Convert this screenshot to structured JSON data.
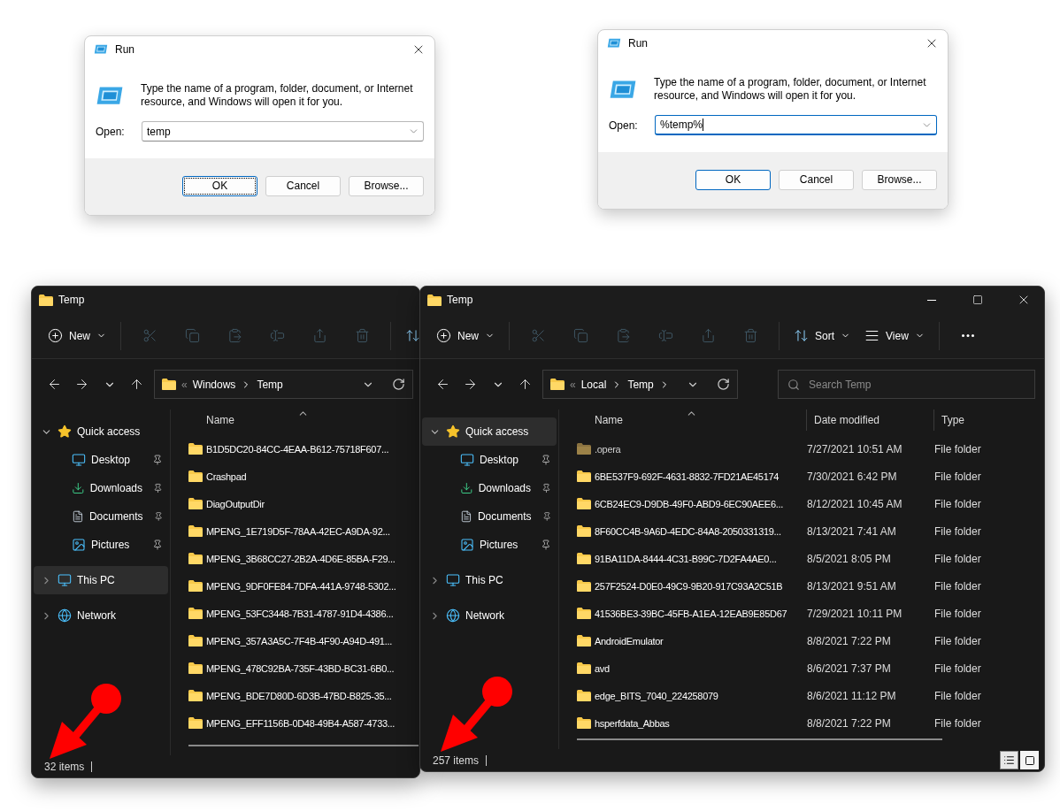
{
  "run_dialogs": [
    {
      "title": "Run",
      "description": "Type the name of a program, folder, document, or Internet resource, and Windows will open it for you.",
      "open_label": "Open:",
      "input": {
        "value": "temp",
        "focused": false
      },
      "buttons": [
        {
          "label": "OK",
          "default": true,
          "focused": true
        },
        {
          "label": "Cancel",
          "default": false,
          "focused": false
        },
        {
          "label": "Browse...",
          "default": false,
          "focused": false
        }
      ]
    },
    {
      "title": "Run",
      "description": "Type the name of a program, folder, document, or Internet resource, and Windows will open it for you.",
      "open_label": "Open:",
      "input": {
        "value": "%temp%",
        "focused": true
      },
      "buttons": [
        {
          "label": "OK",
          "default": true,
          "focused": false
        },
        {
          "label": "Cancel",
          "default": false,
          "focused": false
        },
        {
          "label": "Browse...",
          "default": false,
          "focused": false
        }
      ]
    }
  ],
  "explorers": [
    {
      "title": "Temp",
      "toolbar": [
        {
          "kind": "new",
          "label": "New",
          "disabled": false
        },
        {
          "kind": "separator"
        },
        {
          "kind": "cut",
          "disabled": true
        },
        {
          "kind": "copy",
          "disabled": true
        },
        {
          "kind": "paste",
          "disabled": true
        },
        {
          "kind": "rename",
          "disabled": true
        },
        {
          "kind": "share",
          "disabled": true
        },
        {
          "kind": "delete",
          "disabled": true
        },
        {
          "kind": "separator"
        },
        {
          "kind": "sort",
          "disabled": false
        }
      ],
      "address": {
        "overflow": "«",
        "crumbs": [
          "Windows",
          "Temp"
        ],
        "trailing_chevron": false
      },
      "sidebar": [
        {
          "label": "Quick access",
          "kind": "quick-access",
          "expanded": true,
          "selected": false,
          "children": [
            {
              "label": "Desktop",
              "kind": "desktop",
              "pinned": true,
              "selected": false
            },
            {
              "label": "Downloads",
              "kind": "downloads",
              "pinned": true,
              "selected": false
            },
            {
              "label": "Documents",
              "kind": "documents",
              "pinned": true,
              "selected": false
            },
            {
              "label": "Pictures",
              "kind": "pictures",
              "pinned": true,
              "selected": false
            }
          ]
        },
        {
          "label": "This PC",
          "kind": "this-pc",
          "expanded": false,
          "selected": true
        },
        {
          "label": "Network",
          "kind": "network",
          "expanded": false,
          "selected": false
        }
      ],
      "columns": [
        "Name"
      ],
      "rows": [
        {
          "hidden": false,
          "cells": [
            "B1D5DC20-84CC-4EAA-B612-75718F607..."
          ]
        },
        {
          "hidden": false,
          "cells": [
            "Crashpad"
          ]
        },
        {
          "hidden": false,
          "cells": [
            "DiagOutputDir"
          ]
        },
        {
          "hidden": false,
          "cells": [
            "MPENG_1E719D5F-78AA-42EC-A9DA-92..."
          ]
        },
        {
          "hidden": false,
          "cells": [
            "MPENG_3B68CC27-2B2A-4D6E-85BA-F29..."
          ]
        },
        {
          "hidden": false,
          "cells": [
            "MPENG_9DF0FE84-7DFA-441A-9748-5302..."
          ]
        },
        {
          "hidden": false,
          "cells": [
            "MPENG_53FC3448-7B31-4787-91D4-4386..."
          ]
        },
        {
          "hidden": false,
          "cells": [
            "MPENG_357A3A5C-7F4B-4F90-A94D-491..."
          ]
        },
        {
          "hidden": false,
          "cells": [
            "MPENG_478C92BA-735F-43BD-BC31-6B0..."
          ]
        },
        {
          "hidden": false,
          "cells": [
            "MPENG_BDE7D80D-6D3B-47BD-B825-35..."
          ]
        },
        {
          "hidden": false,
          "cells": [
            "MPENG_EFF1156B-0D48-49B4-A587-4733..."
          ]
        }
      ],
      "status": "32 items"
    },
    {
      "title": "Temp",
      "window_controls": [
        {
          "kind": "minimize"
        },
        {
          "kind": "maximize"
        },
        {
          "kind": "close"
        }
      ],
      "toolbar": [
        {
          "kind": "new",
          "label": "New",
          "disabled": false
        },
        {
          "kind": "separator"
        },
        {
          "kind": "cut",
          "disabled": true
        },
        {
          "kind": "copy",
          "disabled": true
        },
        {
          "kind": "paste",
          "disabled": true
        },
        {
          "kind": "rename",
          "disabled": true
        },
        {
          "kind": "share",
          "disabled": true
        },
        {
          "kind": "delete",
          "disabled": true
        },
        {
          "kind": "separator"
        },
        {
          "kind": "sort",
          "label": "Sort",
          "disabled": false
        },
        {
          "kind": "view",
          "label": "View",
          "disabled": false
        },
        {
          "kind": "separator"
        },
        {
          "kind": "more",
          "disabled": false
        }
      ],
      "address": {
        "overflow": "«",
        "crumbs": [
          "Local",
          "Temp"
        ],
        "trailing_chevron": true
      },
      "search": {
        "placeholder": "Search Temp"
      },
      "sidebar": [
        {
          "label": "Quick access",
          "kind": "quick-access",
          "expanded": true,
          "selected": true,
          "children": [
            {
              "label": "Desktop",
              "kind": "desktop",
              "pinned": true,
              "selected": false
            },
            {
              "label": "Downloads",
              "kind": "downloads",
              "pinned": true,
              "selected": false
            },
            {
              "label": "Documents",
              "kind": "documents",
              "pinned": true,
              "selected": false
            },
            {
              "label": "Pictures",
              "kind": "pictures",
              "pinned": true,
              "selected": false
            }
          ]
        },
        {
          "label": "This PC",
          "kind": "this-pc",
          "expanded": false,
          "selected": false
        },
        {
          "label": "Network",
          "kind": "network",
          "expanded": false,
          "selected": false
        }
      ],
      "columns": [
        "Name",
        "Date modified",
        "Type"
      ],
      "rows": [
        {
          "hidden": true,
          "cells": [
            ".opera",
            "7/27/2021 10:51 AM",
            "File folder"
          ]
        },
        {
          "hidden": false,
          "cells": [
            "6BE537F9-692F-4631-8832-7FD21AE45174",
            "7/30/2021 6:42 PM",
            "File folder"
          ]
        },
        {
          "hidden": false,
          "cells": [
            "6CB24EC9-D9DB-49F0-ABD9-6EC90AEE6...",
            "8/12/2021 10:45 AM",
            "File folder"
          ]
        },
        {
          "hidden": false,
          "cells": [
            "8F60CC4B-9A6D-4EDC-84A8-2050331319...",
            "8/13/2021 7:41 AM",
            "File folder"
          ]
        },
        {
          "hidden": false,
          "cells": [
            "91BA11DA-8444-4C31-B99C-7D2FA4AE0...",
            "8/5/2021 8:05 PM",
            "File folder"
          ]
        },
        {
          "hidden": false,
          "cells": [
            "257F2524-D0E0-49C9-9B20-917C93A2C51B",
            "8/13/2021 9:51 AM",
            "File folder"
          ]
        },
        {
          "hidden": false,
          "cells": [
            "41536BE3-39BC-45FB-A1EA-12EAB9E85D67",
            "7/29/2021 10:11 PM",
            "File folder"
          ]
        },
        {
          "hidden": false,
          "cells": [
            "AndroidEmulator",
            "8/8/2021 7:22 PM",
            "File folder"
          ]
        },
        {
          "hidden": false,
          "cells": [
            "avd",
            "8/6/2021 7:37 PM",
            "File folder"
          ]
        },
        {
          "hidden": false,
          "cells": [
            "edge_BITS_7040_224258079",
            "8/6/2021 11:12 PM",
            "File folder"
          ]
        },
        {
          "hidden": false,
          "cells": [
            "hsperfdata_Abbas",
            "8/8/2021 7:22 PM",
            "File folder"
          ]
        }
      ],
      "status": "257 items",
      "view_modes": [
        {
          "kind": "details",
          "selected": true
        },
        {
          "kind": "tiles",
          "selected": false
        }
      ]
    }
  ]
}
